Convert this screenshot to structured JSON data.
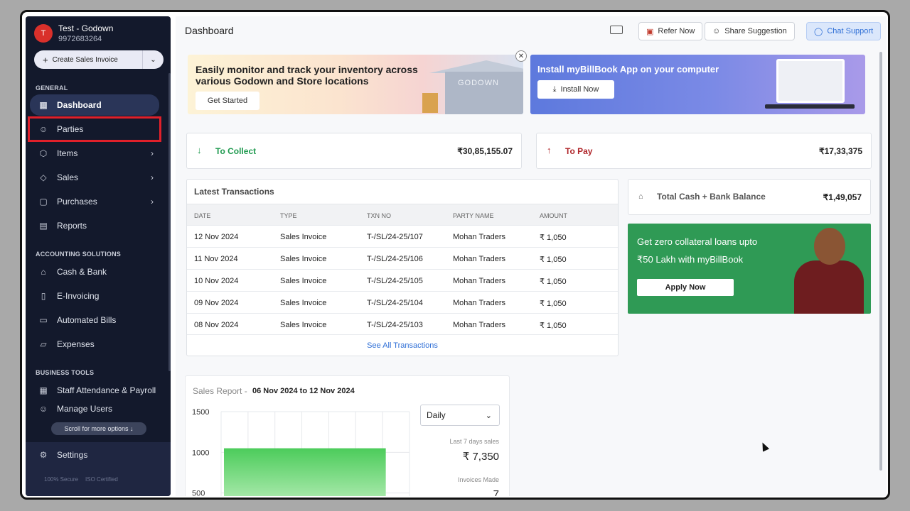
{
  "business": {
    "avatar_letter": "T",
    "name": "Test - Godown",
    "phone": "9972683264"
  },
  "create_button": {
    "label": "Create Sales Invoice",
    "plus": "+",
    "chevron": "⌄"
  },
  "sections": {
    "general": "GENERAL",
    "accounting": "ACCOUNTING SOLUTIONS",
    "business_tools": "BUSINESS TOOLS"
  },
  "nav": {
    "dashboard": "Dashboard",
    "parties": "Parties",
    "items": "Items",
    "sales": "Sales",
    "purchases": "Purchases",
    "reports": "Reports",
    "cash_bank": "Cash & Bank",
    "einvoicing": "E-Invoicing",
    "automated_bills": "Automated Bills",
    "expenses": "Expenses",
    "staff": "Staff Attendance & Payroll",
    "manage_users": "Manage Users",
    "settings": "Settings"
  },
  "scroll_hint": "Scroll for more options ↓",
  "badges": {
    "secure": "100% Secure",
    "iso": "ISO Certified"
  },
  "header": {
    "title": "Dashboard",
    "refer": "Refer Now",
    "suggest": "Share Suggestion",
    "chat": "Chat Support"
  },
  "banner_godown": {
    "text": "Easily monitor and track your inventory across various Godown and Store locations",
    "button": "Get Started",
    "sign": "GODOWN"
  },
  "banner_app": {
    "text": "Install myBillBook App on your computer",
    "button": "Install Now"
  },
  "collect": {
    "label": "To Collect",
    "amount": "₹30,85,155.07"
  },
  "to_pay": {
    "label": "To Pay",
    "amount": "₹17,33,375"
  },
  "cash_bank": {
    "label": "Total Cash + Bank Balance",
    "amount": "₹1,49,057"
  },
  "transactions": {
    "title": "Latest Transactions",
    "headers": [
      "DATE",
      "TYPE",
      "TXN NO",
      "PARTY NAME",
      "AMOUNT"
    ],
    "rows": [
      [
        "12 Nov 2024",
        "Sales Invoice",
        "T-/SL/24-25/107",
        "Mohan Traders",
        "₹ 1,050"
      ],
      [
        "11 Nov 2024",
        "Sales Invoice",
        "T-/SL/24-25/106",
        "Mohan Traders",
        "₹ 1,050"
      ],
      [
        "10 Nov 2024",
        "Sales Invoice",
        "T-/SL/24-25/105",
        "Mohan Traders",
        "₹ 1,050"
      ],
      [
        "09 Nov 2024",
        "Sales Invoice",
        "T-/SL/24-25/104",
        "Mohan Traders",
        "₹ 1,050"
      ],
      [
        "08 Nov 2024",
        "Sales Invoice",
        "T-/SL/24-25/103",
        "Mohan Traders",
        "₹ 1,050"
      ]
    ],
    "see_all": "See All Transactions"
  },
  "loan": {
    "line1": "Get zero collateral loans upto",
    "line2": "₹50 Lakh with myBillBook",
    "button": "Apply Now"
  },
  "sales_report": {
    "title": "Sales Report -",
    "range": "06 Nov 2024 to 12 Nov 2024",
    "period": "Daily",
    "last7_label": "Last 7 days sales",
    "last7_value": "₹ 7,350",
    "invoices_label": "Invoices Made",
    "invoices_value": "7"
  },
  "chart_data": {
    "type": "bar",
    "title": "Sales Report",
    "y_ticks": [
      "1500",
      "1000",
      "500"
    ],
    "ylim": [
      0,
      1500
    ],
    "values": [
      1050,
      1050,
      1050,
      1050,
      1050,
      1050
    ],
    "bar_color": "#4ccc5b"
  },
  "colors": {
    "sidebar": "#13192c",
    "collect": "#1f9a4f",
    "pay": "#b0262a",
    "loan": "#2f9a55",
    "link": "#2f6fd6",
    "highlight": "#e0202a"
  }
}
